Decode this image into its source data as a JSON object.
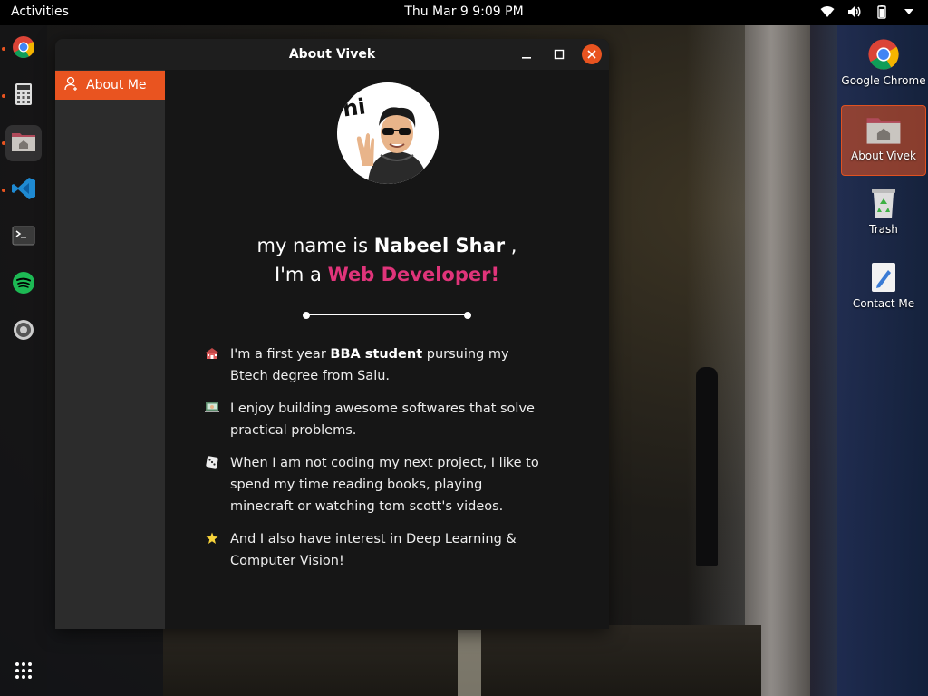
{
  "topbar": {
    "activities": "Activities",
    "clock": "Thu Mar 9  9:09 PM"
  },
  "dock": {
    "items": [
      "chrome",
      "calculator",
      "files",
      "vscode",
      "terminal",
      "spotify",
      "settings"
    ]
  },
  "desktop": {
    "icons": [
      {
        "label": "Google Chrome"
      },
      {
        "label": "About Vivek"
      },
      {
        "label": "Trash"
      },
      {
        "label": "Contact Me"
      }
    ]
  },
  "window": {
    "title": "About Vivek",
    "sidebar": {
      "item": "About Me"
    },
    "intro": {
      "prefix": "my name is ",
      "name": "Nabeel Shar",
      "suffix": " ,",
      "role_prefix": "I'm a ",
      "role": "Web Developer!"
    },
    "avatar_text": "hi",
    "facts": [
      {
        "pre": "I'm a first year ",
        "bold": "BBA student",
        "post": " pursuing my Btech degree from Salu."
      },
      {
        "pre": "I enjoy building awesome softwares that solve practical problems.",
        "bold": "",
        "post": ""
      },
      {
        "pre": "When I am not coding my next project, I like to spend my time reading books, playing minecraft or watching tom scott's videos.",
        "bold": "",
        "post": ""
      },
      {
        "pre": "And I also have interest in Deep Learning & Computer Vision!",
        "bold": "",
        "post": ""
      }
    ]
  },
  "colors": {
    "accent": "#e95420",
    "role": "#e0347a"
  }
}
